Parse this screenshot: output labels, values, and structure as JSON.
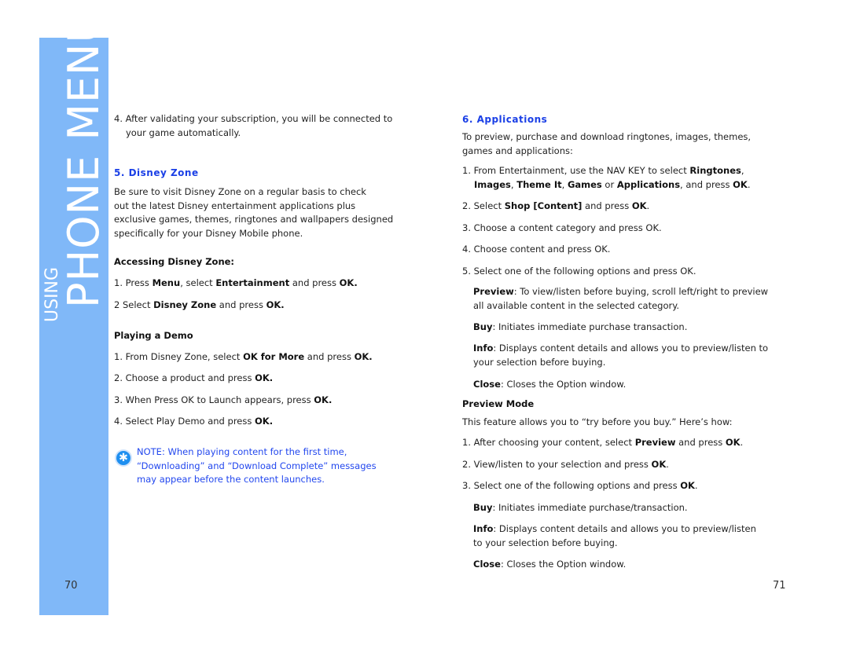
{
  "sidebar": {
    "title": "PHONE MENUS",
    "prefix": "USING",
    "color": "#80b8f8"
  },
  "accent": "#1a3fe6",
  "left": {
    "p1": [
      [
        {
          "t": "4. After validating your subscription, you will be connected to"
        }
      ],
      [
        {
          "t": "your game automatically."
        }
      ]
    ],
    "h5": "5. Disney Zone",
    "p2": [
      [
        {
          "t": "Be sure to visit Disney Zone on a regular basis to check"
        }
      ],
      [
        {
          "t": "out the latest Disney entertainment applications plus"
        }
      ],
      [
        {
          "t": "exclusive games, themes, ringtones and wallpapers designed"
        }
      ],
      [
        {
          "t": "specifically for your Disney Mobile phone."
        }
      ]
    ],
    "sub1": "Accessing Disney Zone:",
    "a1": [
      [
        {
          "t": "1. Press "
        },
        {
          "t": "Menu",
          "b": true
        },
        {
          "t": ", select "
        },
        {
          "t": "Entertainment",
          "b": true
        },
        {
          "t": " and press "
        },
        {
          "t": "OK.",
          "b": true
        }
      ]
    ],
    "a2": [
      [
        {
          "t": "2 Select "
        },
        {
          "t": "Disney Zone",
          "b": true
        },
        {
          "t": " and press "
        },
        {
          "t": "OK.",
          "b": true
        }
      ]
    ],
    "sub2": "Playing a Demo",
    "d1": [
      [
        {
          "t": "1.  From Disney Zone, select "
        },
        {
          "t": "OK for More",
          "b": true
        },
        {
          "t": " and press "
        },
        {
          "t": "OK.",
          "b": true
        }
      ]
    ],
    "d2": [
      [
        {
          "t": "2.  Choose a product and press "
        },
        {
          "t": "OK.",
          "b": true
        }
      ]
    ],
    "d3": [
      [
        {
          "t": "3.  When Press OK to Launch appears, press "
        },
        {
          "t": "OK.",
          "b": true
        }
      ]
    ],
    "d4": [
      [
        {
          "t": "4.  Select Play Demo and press "
        },
        {
          "t": "OK.",
          "b": true
        }
      ]
    ],
    "note_icon": "asterisk-icon",
    "note": [
      [
        {
          "t": "NOTE: When playing content for the first time,"
        }
      ],
      [
        {
          "t": "“Downloading” and “Download Complete” messages"
        }
      ],
      [
        {
          "t": "may appear before the content launches."
        }
      ]
    ],
    "page": "70"
  },
  "right": {
    "h6": "6. Applications",
    "p1": [
      [
        {
          "t": "To preview, purchase and download ringtones, images, themes,"
        }
      ],
      [
        {
          "t": "games and applications:"
        }
      ]
    ],
    "s1": [
      [
        {
          "t": "1. From Entertainment, use the NAV KEY to select "
        },
        {
          "t": "Ringtones",
          "b": true
        },
        {
          "t": ","
        }
      ],
      [
        {
          "t": "Images",
          "b": true
        },
        {
          "t": ", "
        },
        {
          "t": "Theme It",
          "b": true
        },
        {
          "t": ", "
        },
        {
          "t": "Games",
          "b": true
        },
        {
          "t": " or "
        },
        {
          "t": "Applications",
          "b": true
        },
        {
          "t": ", and press "
        },
        {
          "t": "OK",
          "b": true
        },
        {
          "t": "."
        }
      ]
    ],
    "s2": [
      [
        {
          "t": "2. Select "
        },
        {
          "t": "Shop [Content]",
          "b": true
        },
        {
          "t": " and press "
        },
        {
          "t": "OK",
          "b": true
        },
        {
          "t": "."
        }
      ]
    ],
    "s3": [
      [
        {
          "t": "3. Choose a content category and press OK."
        }
      ]
    ],
    "s4": [
      [
        {
          "t": "4. Choose content and press OK."
        }
      ]
    ],
    "s5": [
      [
        {
          "t": "5. Select one of the following options and press OK."
        }
      ]
    ],
    "o1": [
      [
        {
          "t": "Preview",
          "b": true
        },
        {
          "t": ": To view/listen before buying, scroll left/right to preview"
        }
      ],
      [
        {
          "t": "all available content in the selected category."
        }
      ]
    ],
    "o2": [
      [
        {
          "t": "Buy",
          "b": true
        },
        {
          "t": ": Initiates immediate purchase transaction."
        }
      ]
    ],
    "o3": [
      [
        {
          "t": "Info",
          "b": true
        },
        {
          "t": ": Displays content details and allows you to preview/listen to"
        }
      ],
      [
        {
          "t": "your selection before buying."
        }
      ]
    ],
    "o4": [
      [
        {
          "t": "Close",
          "b": true
        },
        {
          "t": ": Closes the Option window."
        }
      ]
    ],
    "sub": "Preview Mode",
    "p2": [
      [
        {
          "t": "This feature allows you to “try before you buy.” Here’s how:"
        }
      ]
    ],
    "m1": [
      [
        {
          "t": "1. After choosing your content, select "
        },
        {
          "t": "Preview",
          "b": true
        },
        {
          "t": " and press "
        },
        {
          "t": "OK",
          "b": true
        },
        {
          "t": "."
        }
      ]
    ],
    "m2": [
      [
        {
          "t": "2. View/listen to your selection and press "
        },
        {
          "t": "OK",
          "b": true
        },
        {
          "t": "."
        }
      ]
    ],
    "m3": [
      [
        {
          "t": "3. Select one of the following options and press "
        },
        {
          "t": "OK",
          "b": true
        },
        {
          "t": "."
        }
      ]
    ],
    "q1": [
      [
        {
          "t": "Buy",
          "b": true
        },
        {
          "t": ": Initiates immediate purchase/transaction."
        }
      ]
    ],
    "q2": [
      [
        {
          "t": "Info",
          "b": true
        },
        {
          "t": ": Displays content details and allows you to preview/listen"
        }
      ],
      [
        {
          "t": "to your selection before buying."
        }
      ]
    ],
    "q3": [
      [
        {
          "t": "Close",
          "b": true
        },
        {
          "t": ": Closes the Option window."
        }
      ]
    ],
    "page": "71"
  }
}
